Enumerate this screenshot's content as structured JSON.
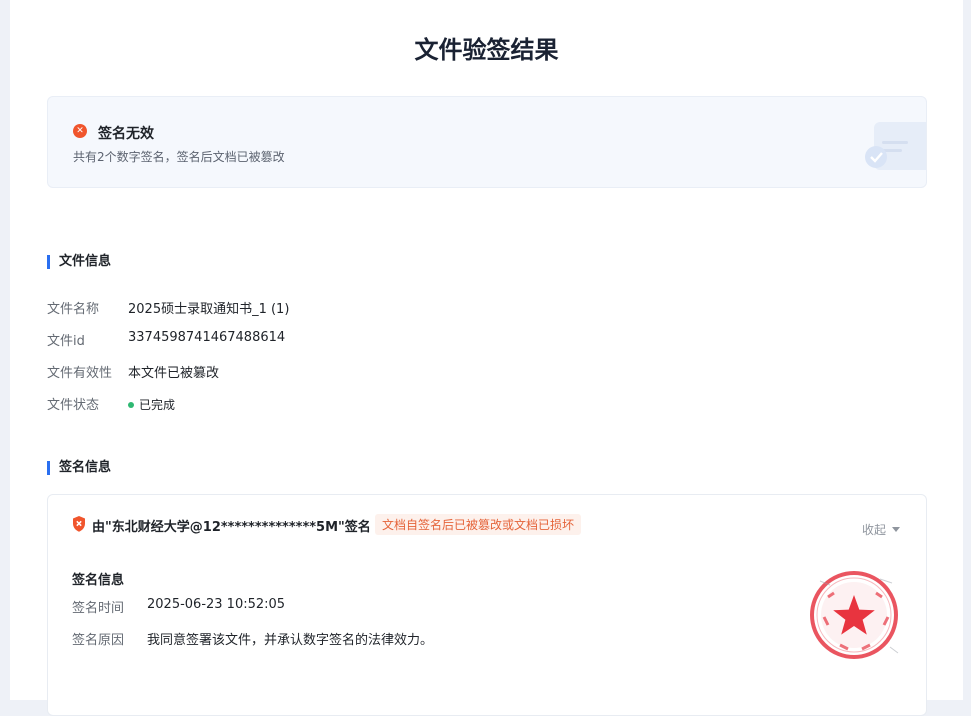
{
  "page": {
    "title": "文件验签结果"
  },
  "banner": {
    "title": "签名无效",
    "subtitle": "共有2个数字签名，签名后文档已被篡改",
    "icon": "error-circle-icon",
    "error_color": "#f0552d"
  },
  "file_info": {
    "heading": "文件信息",
    "rows": [
      {
        "label": "文件名称",
        "value": "2025硕士录取通知书_1 (1)"
      },
      {
        "label": "文件id",
        "value": "3374598741467488614"
      },
      {
        "label": "文件有效性",
        "value": "本文件已被篡改"
      },
      {
        "label": "文件状态",
        "value": "已完成"
      }
    ],
    "status_color": "#2eb872"
  },
  "sign_info": {
    "heading": "签名信息",
    "card": {
      "signer_title": "由\"东北财经大学@12**************5M\"签名",
      "warning_tag": "文档自签名后已被篡改或文档已损坏",
      "collapse_label": "收起",
      "sub_heading": "签名信息",
      "rows": [
        {
          "label": "签名时间",
          "value": "2025-06-23 10:52:05"
        },
        {
          "label": "签名原因",
          "value": "我同意签署该文件，并承认数字签名的法律效力。"
        }
      ],
      "seal_icon": "red-official-seal-icon"
    }
  }
}
